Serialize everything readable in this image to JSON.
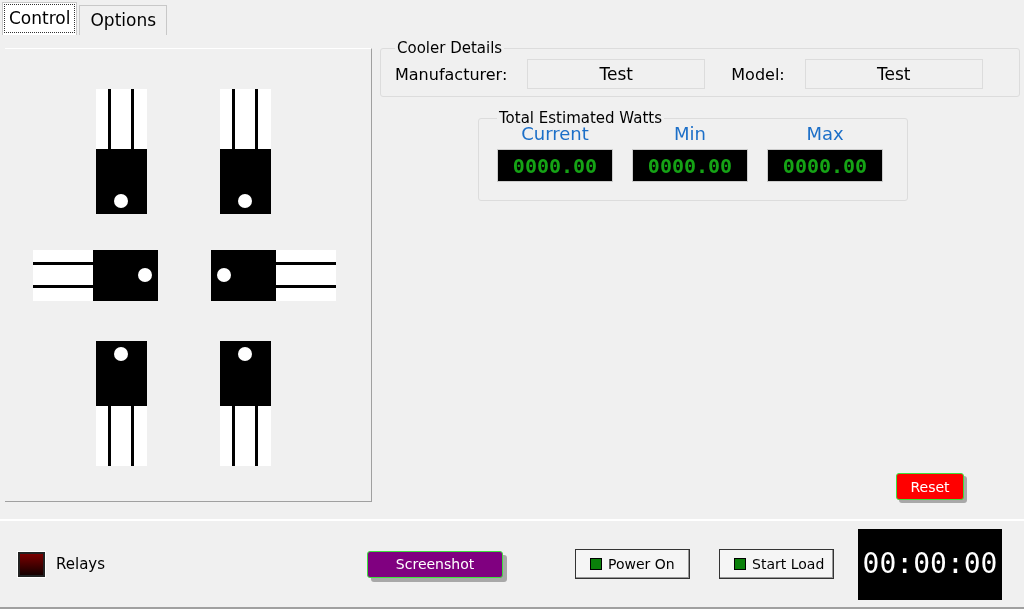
{
  "tabs": [
    {
      "label": "Control",
      "selected": true
    },
    {
      "label": "Options",
      "selected": false
    }
  ],
  "cooler_details": {
    "title": "Cooler Details",
    "fields": [
      {
        "label": "Manufacturer:",
        "value": "Test"
      },
      {
        "label": "Model:",
        "value": "Test"
      }
    ]
  },
  "total_estimated_watts": {
    "title": "Total Estimated Watts",
    "readouts": [
      {
        "label": "Current",
        "value": "0000.00"
      },
      {
        "label": "Min",
        "value": "0000.00"
      },
      {
        "label": "Max",
        "value": "0000.00"
      }
    ]
  },
  "reset_button": "Reset",
  "bottom_bar": {
    "relays_label": "Relays",
    "screenshot_button": "Screenshot",
    "power_on_button": "Power On",
    "start_load_button": "Start Load",
    "timer": "00:00:00"
  }
}
